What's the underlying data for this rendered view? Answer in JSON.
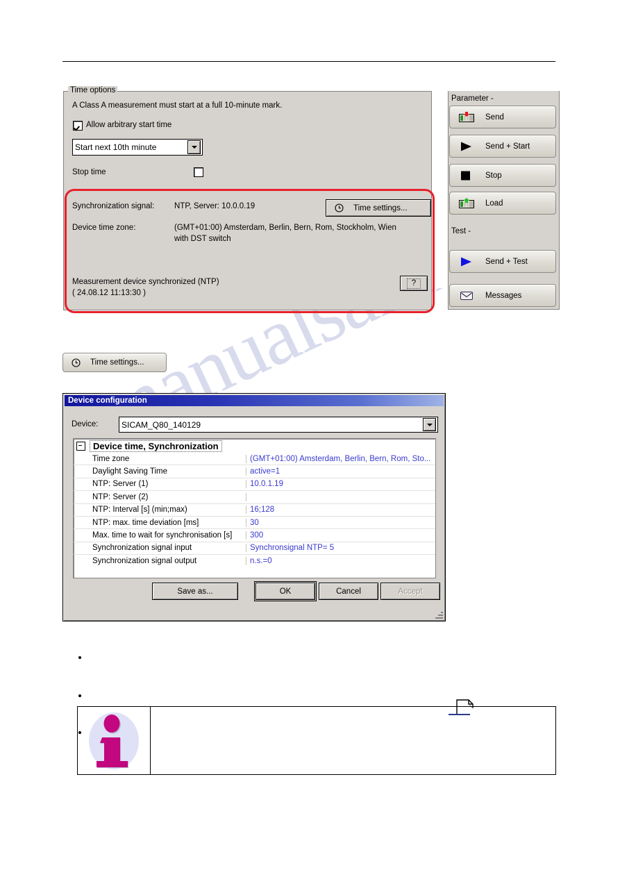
{
  "time_options": {
    "group_label": "Time options",
    "notice": "A Class A measurement must start at a full 10-minute mark.",
    "allow_arbitrary_label": "Allow arbitrary start time",
    "allow_arbitrary_checked": true,
    "start_mode_value": "Start next 10th minute",
    "stop_time_label": "Stop time",
    "stop_time_checked": false,
    "sync_signal_label": "Synchronization signal:",
    "sync_signal_value": "NTP, Server: 10.0.0.19",
    "time_settings_button": "Time settings...",
    "device_tz_label": "Device time zone:",
    "device_tz_value_line1": "(GMT+01:00) Amsterdam, Berlin, Bern, Rom, Stockholm, Wien",
    "device_tz_value_line2": "with DST switch",
    "status_line1": "Measurement device synchronized (NTP)",
    "status_line2": "( 24.08.12 11:13:30 )",
    "help_button": "?",
    "highlight_color": "#e8202a"
  },
  "side_panel": {
    "parameter_heading": "Parameter -",
    "test_heading": "Test -",
    "buttons": [
      {
        "label": "Send",
        "icon": "device-send-icon"
      },
      {
        "label": "Send + Start",
        "icon": "play-black-icon"
      },
      {
        "label": "Stop",
        "icon": "stop-square-icon"
      },
      {
        "label": "Load",
        "icon": "device-load-icon"
      }
    ],
    "test_buttons": [
      {
        "label": "Send + Test",
        "icon": "play-blue-icon"
      },
      {
        "label": "Messages",
        "icon": "envelope-icon"
      }
    ]
  },
  "standalone_button": {
    "label": "Time settings...",
    "icon": "clock-icon"
  },
  "dialog": {
    "title": "Device configuration",
    "device_label": "Device:",
    "device_value": "SICAM_Q80_140129",
    "group_title": "Device time, Synchronization",
    "rows": [
      {
        "name": "Time zone",
        "value": "(GMT+01:00) Amsterdam, Berlin, Bern, Rom, Sto..."
      },
      {
        "name": "Daylight Saving Time",
        "value": "active=1"
      },
      {
        "name": "NTP: Server (1)",
        "value": "10.0.1.19"
      },
      {
        "name": "NTP: Server (2)",
        "value": ""
      },
      {
        "name": "NTP: Interval [s] (min;max)",
        "value": "16;128"
      },
      {
        "name": "NTP: max. time deviation [ms]",
        "value": "30"
      },
      {
        "name": "Max. time to wait for synchronisation [s]",
        "value": "300"
      },
      {
        "name": "Synchronization signal input",
        "value": "Synchronsignal NTP= 5"
      },
      {
        "name": "Synchronization signal output",
        "value": "n.s.=0"
      }
    ],
    "buttons": {
      "save_as": "Save as...",
      "ok": "OK",
      "cancel": "Cancel",
      "accept": "Accept"
    },
    "accept_disabled": true
  },
  "watermark": {
    "text": "manualsarchive.com"
  }
}
